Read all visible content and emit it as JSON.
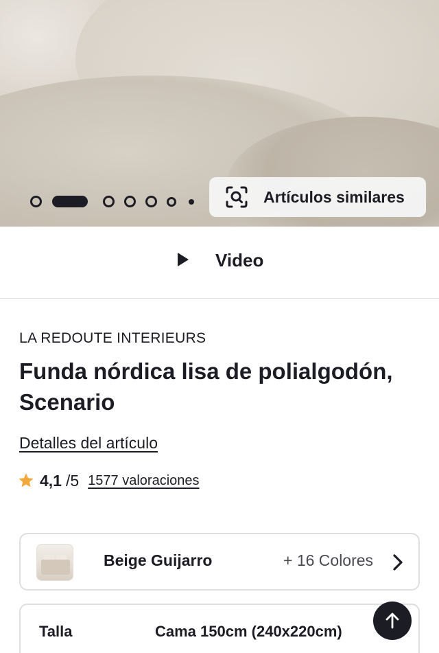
{
  "hero": {
    "carousel_dots": 7,
    "active_dot_index": 1,
    "similar_button_label": "Artículos similares",
    "icons": {
      "similar": "image-search-icon"
    }
  },
  "video": {
    "label": "Video",
    "icon": "play-icon"
  },
  "product": {
    "brand": "LA REDOUTE INTERIEURS",
    "title": "Funda nórdica lisa de polialgodón, Scenario",
    "details_link": "Detalles del artículo"
  },
  "rating": {
    "score": "4,1",
    "out_of": "/5",
    "count_label": "1577 valoraciones",
    "star_color": "#F2A93B"
  },
  "color_selector": {
    "selected_color": "Beige Guijarro",
    "more_colors": "+ 16 Colores",
    "icon": "chevron-right-icon"
  },
  "size_selector": {
    "label": "Talla",
    "value": "Cama 150cm (240x220cm)"
  },
  "scroll_top": {
    "icon": "arrow-up-icon"
  },
  "colors": {
    "text": "#1C1C24",
    "border": "#DEDEDE",
    "accent": "#F2A93B"
  }
}
